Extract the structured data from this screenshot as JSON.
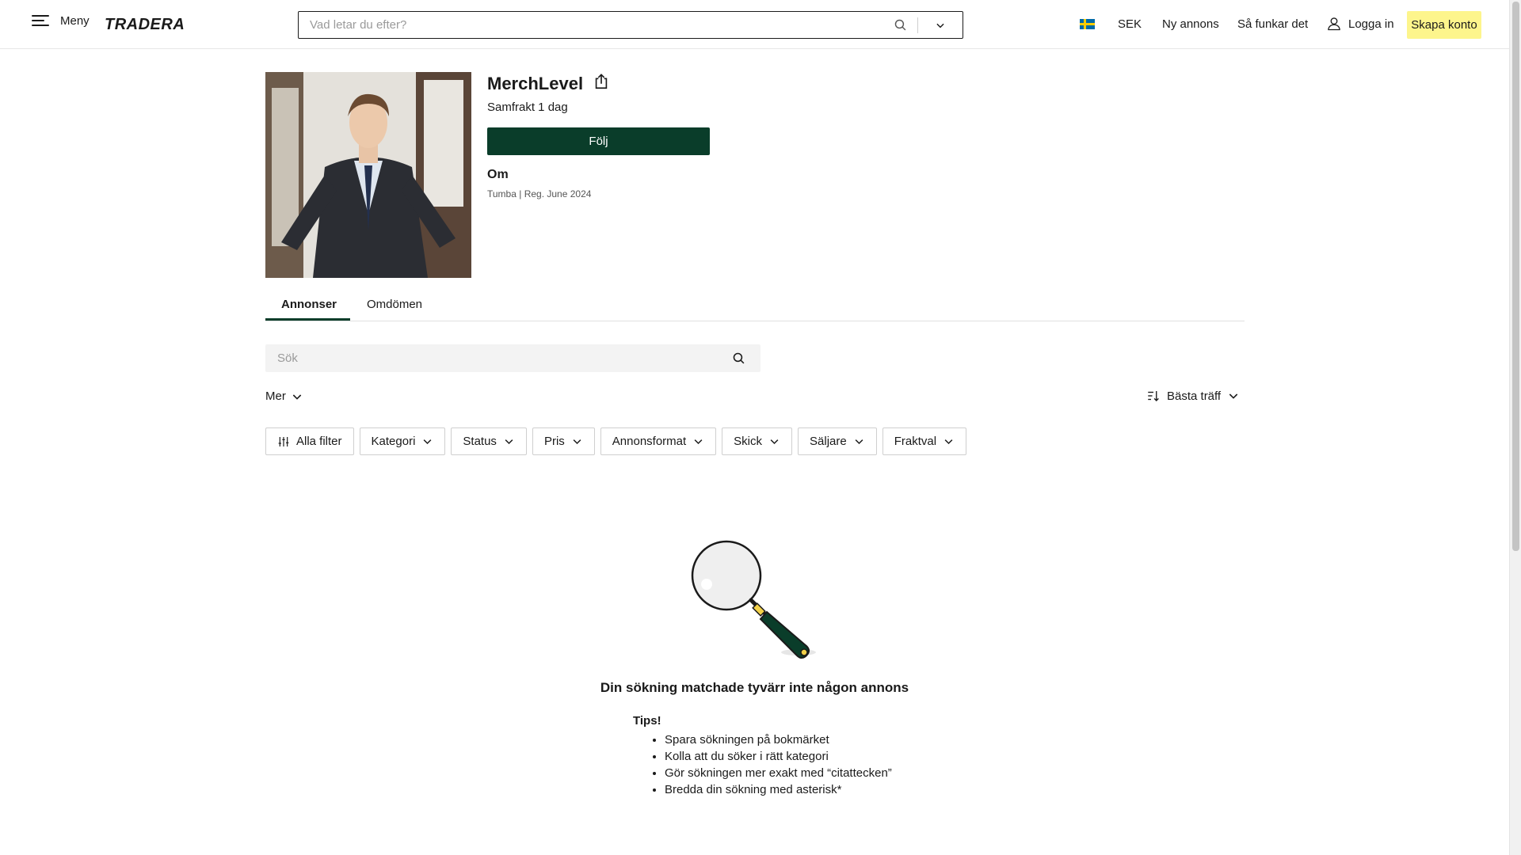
{
  "header": {
    "menu_label": "Meny",
    "logo_text": "TRADERA",
    "search_placeholder": "Vad letar du efter?",
    "currency": "SEK",
    "new_listing": "Ny annons",
    "how_it_works": "Så funkar det",
    "login": "Logga in",
    "create_account": "Skapa konto"
  },
  "profile": {
    "name": "MerchLevel",
    "samfrakt": "Samfrakt 1 dag",
    "follow_label": "Följ",
    "about_title": "Om",
    "about_info": "Tumba | Reg. June 2024"
  },
  "tabs": [
    {
      "label": "Annonser",
      "active": true
    },
    {
      "label": "Omdömen",
      "active": false
    }
  ],
  "shop_search": {
    "placeholder": "Sök"
  },
  "more_label": "Mer",
  "sort_label": "Bästa träff",
  "filters": [
    {
      "label": "Alla filter",
      "icon": "sliders-icon"
    },
    {
      "label": "Kategori"
    },
    {
      "label": "Status"
    },
    {
      "label": "Pris"
    },
    {
      "label": "Annonsformat"
    },
    {
      "label": "Skick"
    },
    {
      "label": "Säljare"
    },
    {
      "label": "Fraktval"
    }
  ],
  "empty_state": {
    "title": "Din sökning matchade tyvärr inte någon annons",
    "tips_title": "Tips!",
    "tips": [
      "Spara sökningen på bokmärket",
      "Kolla att du söker i rätt kategori",
      "Gör sökningen mer exakt med “citattecken”",
      "Bredda din sökning med asterisk*"
    ]
  },
  "colors": {
    "brand_green": "#0a3d2a",
    "cta_yellow": "#fdf58c"
  }
}
